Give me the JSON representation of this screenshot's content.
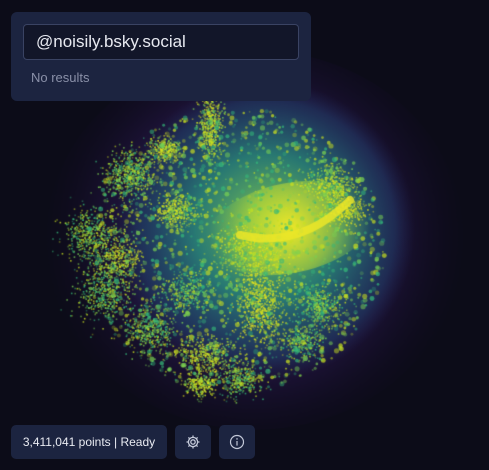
{
  "search": {
    "value": "@noisily.bsky.social",
    "empty_message": "No results"
  },
  "status": {
    "text": "3,411,041 points | Ready"
  },
  "toolbar": {
    "settings_icon": "gear-icon",
    "info_icon": "info-icon"
  },
  "colors": {
    "background": "#0c0c18",
    "panel": "#1c2440",
    "colormap": [
      "#2a0f4a",
      "#2b3f7d",
      "#21908c",
      "#5ec962",
      "#e6e41e"
    ]
  }
}
